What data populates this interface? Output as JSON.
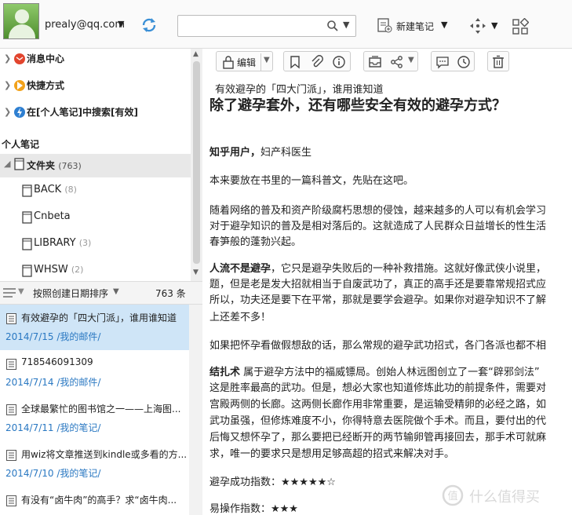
{
  "toolbar": {
    "account": "prealy@qq.com",
    "search_placeholder": "",
    "new_note_label": "新建笔记"
  },
  "tree": {
    "messages": "消息中心",
    "shortcuts": "快捷方式",
    "search_in_notes": "在[个人笔记]中搜索[有效]",
    "section_title": "个人笔记",
    "folders_label": "文件夹",
    "folders_count": "(763)",
    "subfolders": [
      {
        "label": "BACK",
        "count": "(8)"
      },
      {
        "label": "Cnbeta",
        "count": ""
      },
      {
        "label": "LIBRARY",
        "count": "(3)"
      },
      {
        "label": "WHSW",
        "count": "(2)"
      }
    ]
  },
  "sort": {
    "label": "按照创建日期排序",
    "count": "763 条"
  },
  "notes": [
    {
      "title": "有效避孕的「四大门派」，谁用谁知道",
      "date": "2014/7/15",
      "folder": "/我的邮件/",
      "selected": true
    },
    {
      "title": "718546091309",
      "date": "2014/7/14",
      "folder": "/我的邮件/",
      "selected": false
    },
    {
      "title": "全球最繁忙的图书馆之一——上海图...",
      "date": "2014/7/11",
      "folder": "/我的笔记/",
      "selected": false
    },
    {
      "title": "用wiz将文章推送到kindle或多看的方...",
      "date": "2014/7/10",
      "folder": "/我的笔记/",
      "selected": false
    },
    {
      "title": "有没有“卤牛肉”的高手？求“卤牛肉...",
      "date": "",
      "folder": "",
      "selected": false
    }
  ],
  "note_toolbar": {
    "edit_label": "编辑"
  },
  "note": {
    "title": "有效避孕的「四大门派」，谁用谁知道",
    "heading": "除了避孕套外，还有哪些安全有效的避孕方式？",
    "author_bold": "知乎用户，",
    "author_rest": "妇产科医生",
    "p1": "本来要放在书里的一篇科普文，先贴在这吧。",
    "p2_l1": "随着网络的普及和资产阶级腐朽思想的侵蚀，越来越多的人可以有机会学习",
    "p2_l2": "对于避孕知识的普及是相对落后的。这就造成了人民群众日益增长的性生活",
    "p2_l3": "春笋般的蓬勃兴起。",
    "p3_bold": "人流不是避孕",
    "p3_l1_rest": "，它只是避孕失败后的一种补救措施。这就好像武侠小说里，",
    "p3_l2": "题，但是老是发大招就相当于自废武功了，真正的高手还是要靠常规招式应",
    "p3_l3": "所以，功夫还是要下在平常，那就是要学会避孕。如果你对避孕知识不了解",
    "p3_l4": "上还差不多！",
    "p4": "如果把怀孕看做假想敌的话，那么常规的避孕武功招式，各门各派也都不相",
    "p5_bold": "结扎术",
    "p5_l1_rest": " 属于避孕方法中的福威镖局。创始人林远图创立了一套“辟邪剑法”",
    "p5_l2": "这是胜率最高的武功。但是，想必大家也知道修炼此功的前提条件，需要对",
    "p5_l3": "宫殿两侧的长廊。这两侧长廊作用非常重要，是运输受精卵的必经之路，如",
    "p5_l4": "武功虽强，但修炼难度不小，你得特意去医院做个手术。而且，要付出的代",
    "p5_l5": "后悔又想怀孕了，那么要把已经断开的两节输卵管再接回去，那手术可就麻",
    "p5_l6": "求，唯一的要求只是想用足够高超的招式来解决对手。",
    "rating1": "避孕成功指数：★★★★★☆",
    "rating2": "易操作指数：★★★"
  },
  "watermark": "什么值得买",
  "colors": {
    "link": "#2a78c2",
    "selected": "#cfe5f7"
  }
}
